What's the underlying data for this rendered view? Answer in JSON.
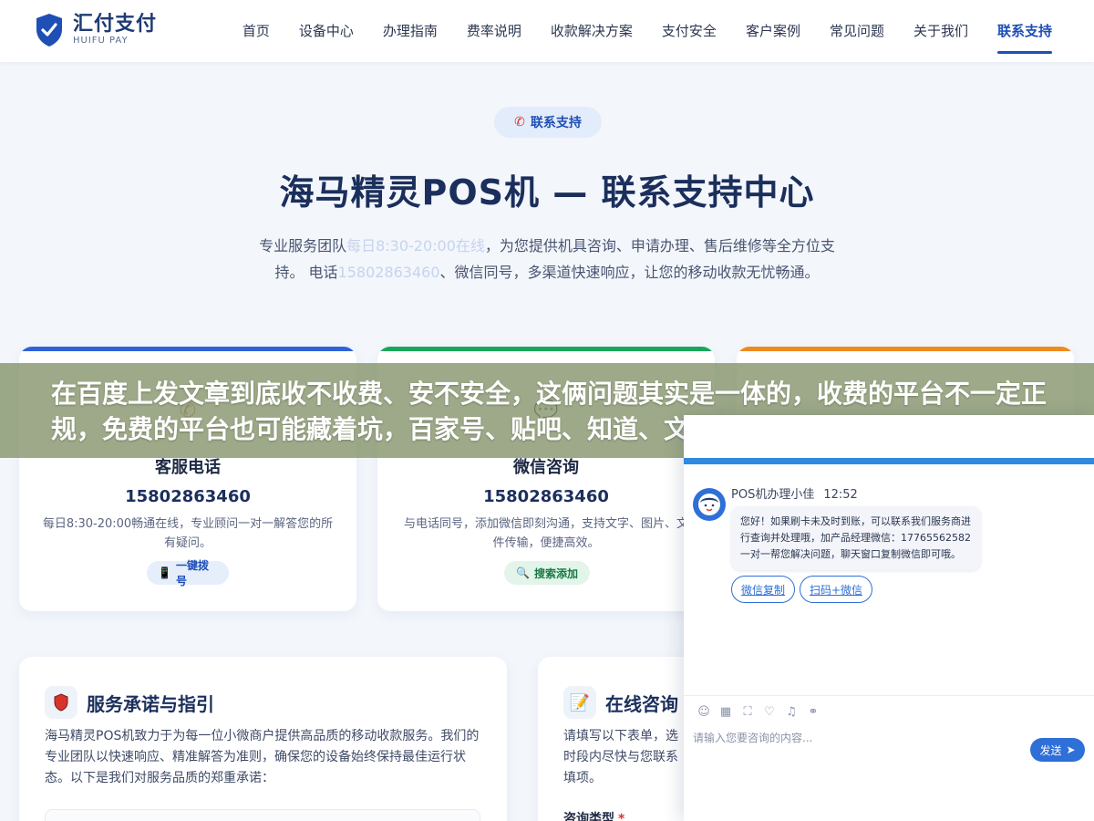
{
  "brand": {
    "name_cn": "汇付支付",
    "name_en": "HUIFU PAY",
    "color": "#1e4fb5"
  },
  "nav": {
    "items": [
      {
        "label": "首页"
      },
      {
        "label": "设备中心"
      },
      {
        "label": "办理指南"
      },
      {
        "label": "费率说明"
      },
      {
        "label": "收款解决方案"
      },
      {
        "label": "支付安全"
      },
      {
        "label": "客户案例"
      },
      {
        "label": "常见问题"
      },
      {
        "label": "关于我们"
      },
      {
        "label": "联系支持",
        "active": true
      }
    ]
  },
  "hero": {
    "pill": "联系支持",
    "pill_icon": "phone-icon",
    "title": "海马精灵POS机 — 联系支持中心",
    "desc_a": "专业服务团队",
    "desc_b": "每日8:30-20:00在线",
    "desc_c": "，为您提供机具咨询、申请办理、售后维修等全方位支持。 电话",
    "desc_d": "15802863460",
    "desc_e": "、微信同号，多渠道快速响应，让您的移动收款无忧畅通。"
  },
  "cards": [
    {
      "title": "客服电话",
      "number": "15802863460",
      "desc": "每日8:30-20:00畅通在线，专业顾问一对一解答您的所有疑问。",
      "button": "一键拨号",
      "button_icon": "mobile-icon",
      "color": "#2e62d8"
    },
    {
      "title": "微信咨询",
      "number": "15802863460",
      "desc": "与电话同号，添加微信即刻沟通，支持文字、图片、文件传输，便捷高效。",
      "button": "搜索添加",
      "button_icon": "search-icon",
      "color": "#1aa65a"
    },
    {
      "color": "#ef8a1f"
    }
  ],
  "panels": {
    "service": {
      "title": "服务承诺与指引",
      "icon": "shield-icon",
      "text": "海马精灵POS机致力于为每一位小微商户提供高品质的移动收款服务。我们的专业团队以快速响应、精准解答为准则，确保您的设备始终保持最佳运行状态。以下是我们对服务品质的郑重承诺："
    },
    "consult": {
      "title": "在线咨询",
      "icon": "memo-icon",
      "text": "请填写以下表单，选\n时段内尽快与您联系\n填项。",
      "field_label": "咨询类型"
    }
  },
  "overlay": {
    "text": "在百度上发文章到底收不收费、安不安全，这俩问题其实是一体的，收费的平台不一定正规，免费的平台也可能藏着坑，百家号、贴吧、知道、文"
  },
  "chat": {
    "agent": "POS机办理小佳",
    "time": "12:52",
    "message": "您好！如果刷卡未及时到账，可以联系我们服务商进行查询并处理哦，加产品经理微信：17765562582 一对一帮您解决问题，聊天窗口复制微信即可哦。",
    "options": [
      "微信复制",
      "扫码+微信"
    ],
    "placeholder": "请输入您要咨询的内容...",
    "send": "发送",
    "accent": "#2e6fd8"
  }
}
